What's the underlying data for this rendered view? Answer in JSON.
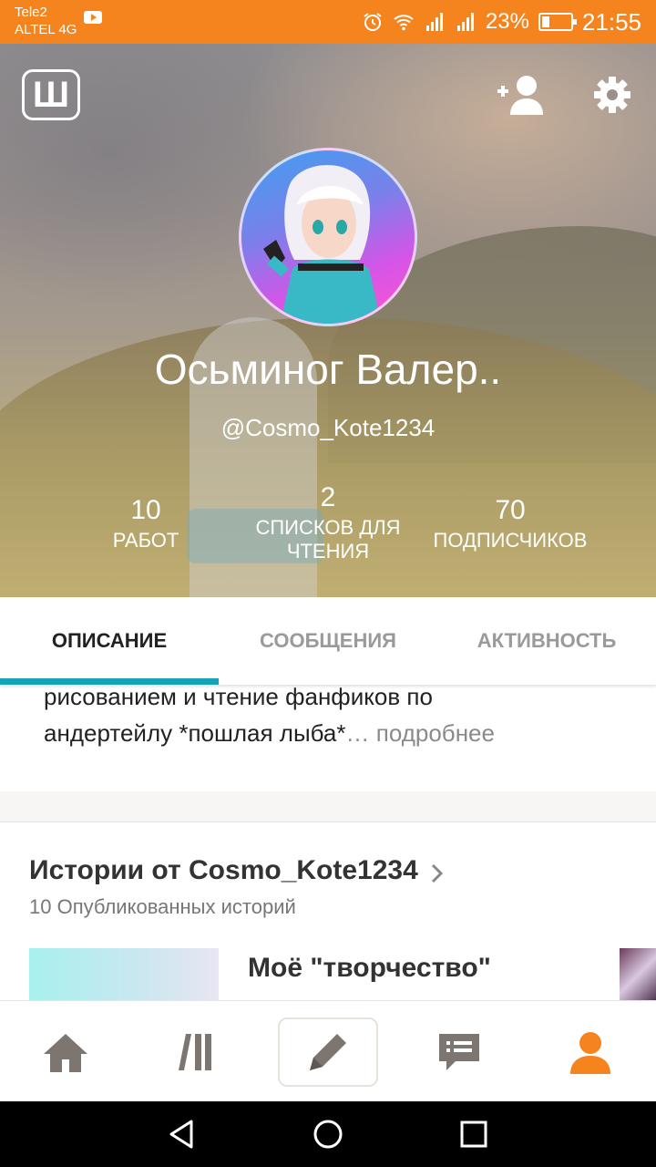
{
  "status_bar": {
    "carrier_line1": "Tele2",
    "carrier_line2": "ALTEL 4G",
    "battery": "23%",
    "time": "21:55",
    "icons": [
      "youtube-icon",
      "alarm-icon",
      "wifi-icon",
      "signal-icon",
      "signal-icon",
      "battery-icon"
    ]
  },
  "header": {
    "logo_letter": "Ш",
    "username": "Осьминог Валер..",
    "handle": "@Cosmo_Kote1234",
    "stats": [
      {
        "value": "10",
        "label": "РАБОТ"
      },
      {
        "value": "2",
        "label_line1": "СПИСКОВ ДЛЯ",
        "label_line2": "ЧТЕНИЯ"
      },
      {
        "value": "70",
        "label": "ПОДПИСЧИКОВ"
      }
    ]
  },
  "tabs": [
    {
      "label": "ОПИСАНИЕ",
      "active": true
    },
    {
      "label": "СООБЩЕНИЯ",
      "active": false
    },
    {
      "label": "АКТИВНОСТЬ",
      "active": false
    }
  ],
  "description": {
    "line1": "рисованием и чтение фанфиков по",
    "line2": "андертейлу *пошлая лыба*",
    "ellipsis": "…",
    "more": "подробнее"
  },
  "stories": {
    "title": "Истории от Cosmo_Kote1234",
    "count": "10 Опубликованных историй",
    "first_story_title": "Моё \"творчество\""
  },
  "colors": {
    "accent": "#f5841f",
    "tab_indicator": "#17a2b8",
    "active_nav": "#f5841f",
    "inactive_nav": "#7d7570"
  }
}
